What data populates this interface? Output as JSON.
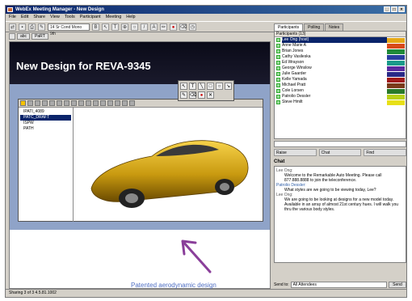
{
  "window": {
    "title": "WebEx Meeting Manager - New Design"
  },
  "menu": [
    "File",
    "Edit",
    "Share",
    "View",
    "Tools",
    "Participant",
    "Meeting",
    "Help"
  ],
  "toolbar": {
    "font_select": "14  Sr Cond Mono 9th"
  },
  "slide_tabs": [
    "",
    "abc",
    "PaRT"
  ],
  "stage": {
    "banner_title": "New Design for REVA-9345",
    "tree_items": [
      "IPATI_4089",
      "PATC_DRAFT",
      "ISPW",
      "PATH"
    ],
    "caption": "Patented aerodynamic design"
  },
  "right_panel": {
    "tabs": [
      "Participants",
      "Polling",
      "Notes"
    ],
    "list_header": "Participants (13)",
    "participants": [
      {
        "name": "Lee Ong (host)",
        "color": "#e5a818"
      },
      {
        "name": "Anne Marie A",
        "color": "#d84a1a"
      },
      {
        "name": "Brian Jones",
        "color": "#1f8a3a"
      },
      {
        "name": "Cathy Vasileska",
        "color": "#2a3fa0"
      },
      {
        "name": "Ed Wrayson",
        "color": "#1a9a8a"
      },
      {
        "name": "George Winslow",
        "color": "#5a2aa0"
      },
      {
        "name": "Julie Gaarder",
        "color": "#2a2a88"
      },
      {
        "name": "Kelle Yamada",
        "color": "#a01a1a"
      },
      {
        "name": "Michael Pratt",
        "color": "#7a3a1a"
      },
      {
        "name": "Cole Lorsen",
        "color": "#2a7a2a"
      },
      {
        "name": "Patrolio Dessler",
        "color": "#b8d018"
      },
      {
        "name": "Steve Hmilt",
        "color": "#e8e018"
      }
    ],
    "buttons": {
      "raise_hand": "Raise",
      "chat": "Chat",
      "find": "Find"
    },
    "chat_label": "Chat",
    "chat_log": [
      {
        "who": "Lee Ong:",
        "text": "Welcome to the Remarkable Auto Meeting. Please call 877.888.8888 to join the teleconference.",
        "blue": false
      },
      {
        "who": "Patrolio Dessler:",
        "text": "What styles are we going to be viewing today, Lee?",
        "blue": true
      },
      {
        "who": "Lee Ong:",
        "text": "We are going to be looking at designs for a new model today. Available in an array of almost 21st century hues. I will walk you thru the various body styles.",
        "blue": false
      }
    ],
    "send_to_label": "Send to:",
    "send_to_value": "All Attendees",
    "send_button": "Send"
  },
  "status": {
    "left": "Sharing 3 of 3  4.5.81.1002"
  }
}
